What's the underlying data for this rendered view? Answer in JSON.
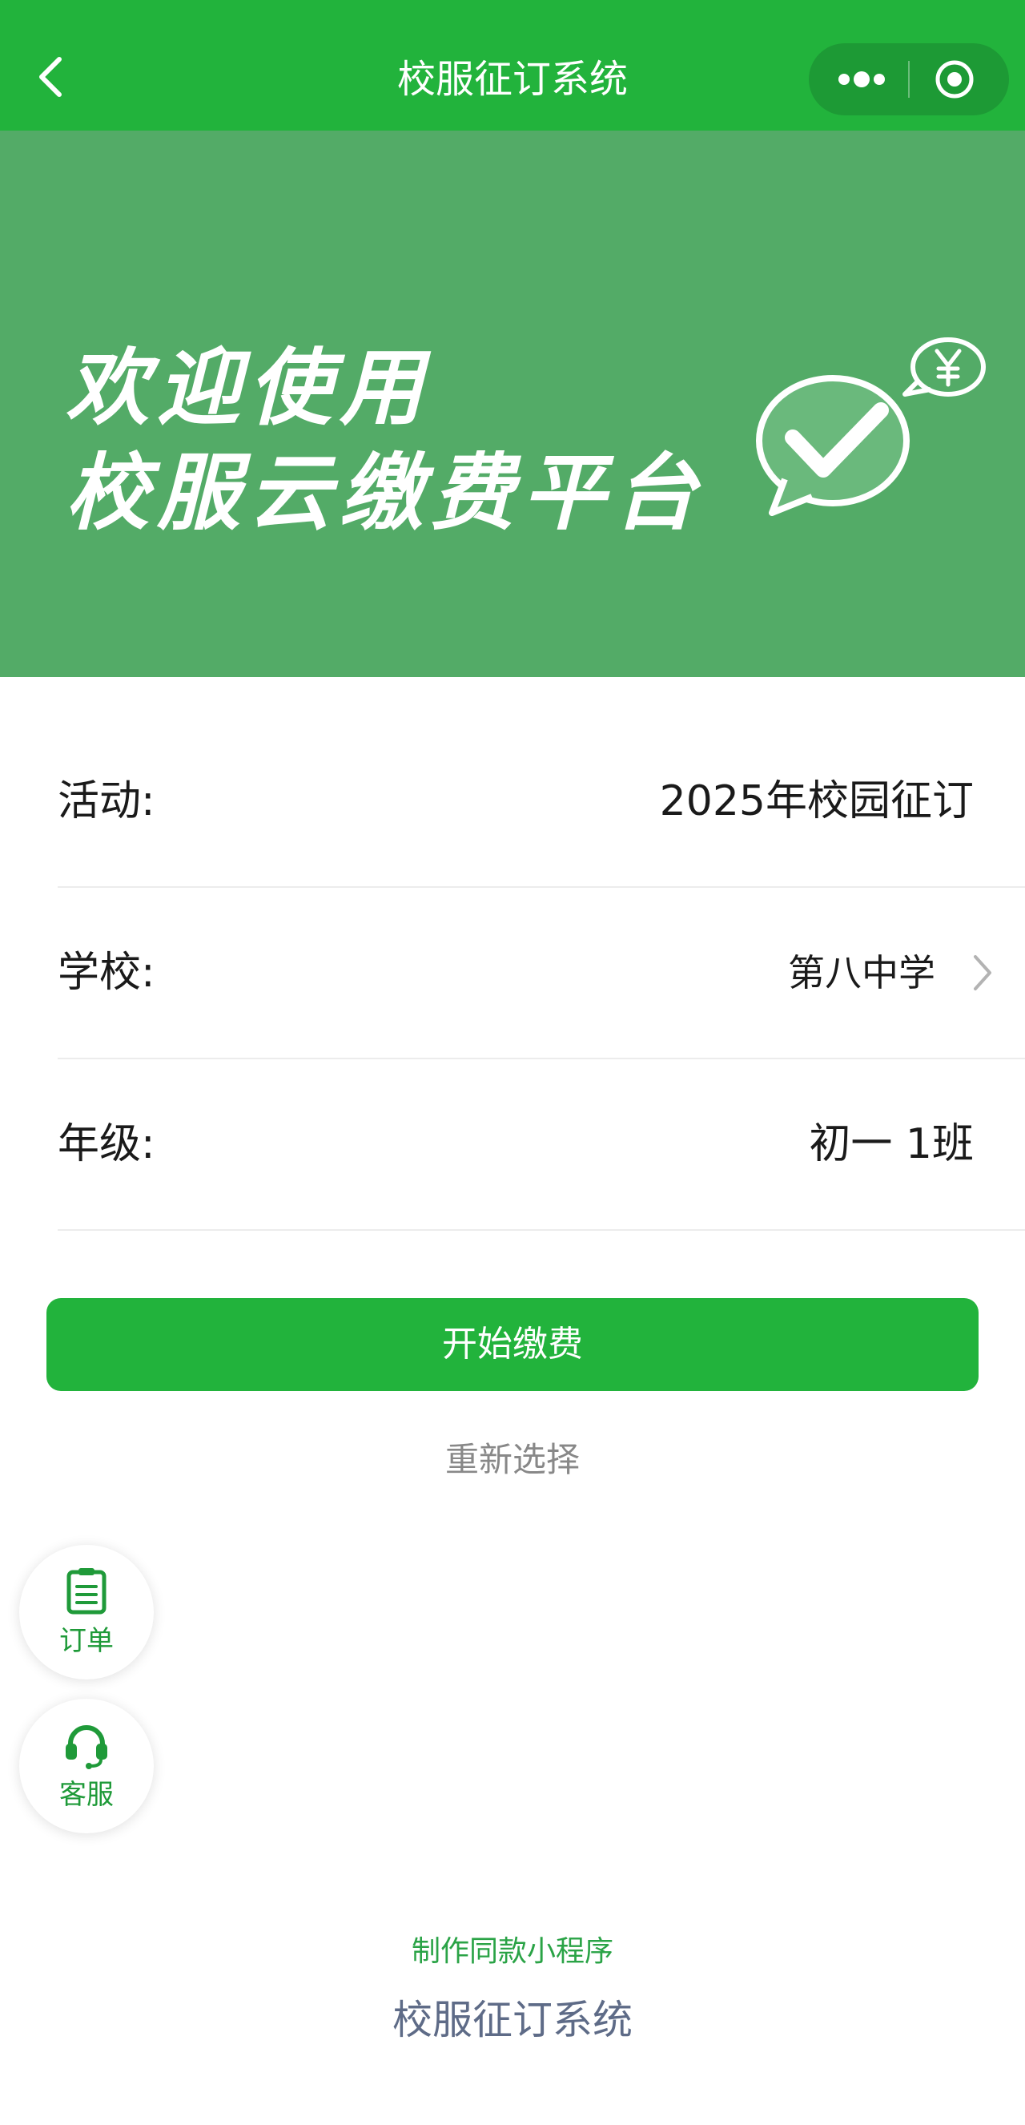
{
  "nav": {
    "title": "校服征订系统"
  },
  "banner": {
    "line1": "欢迎使用",
    "line2": "校服云缴费平台"
  },
  "form": {
    "activity": {
      "label": "活动:",
      "value": "2025年校园征订"
    },
    "school": {
      "label": "学校:",
      "value": "第八中学"
    },
    "grade": {
      "label": "年级:",
      "value": "初一 1班"
    }
  },
  "actions": {
    "pay_label": "开始缴费",
    "reselect_label": "重新选择"
  },
  "floating": {
    "orders_label": "订单",
    "service_label": "客服"
  },
  "footer": {
    "make_same_label": "制作同款小程序",
    "app_name": "校服征订系统"
  },
  "colors": {
    "brand_green": "#22b33c",
    "banner_green": "#53ab67",
    "footer_text": "#5e6b87"
  },
  "icons": [
    "back-arrow-icon",
    "more-dots-icon",
    "close-target-icon",
    "wechat-pay-check-icon",
    "yen-bubble-icon",
    "chevron-right-icon",
    "order-list-icon",
    "headset-icon"
  ]
}
